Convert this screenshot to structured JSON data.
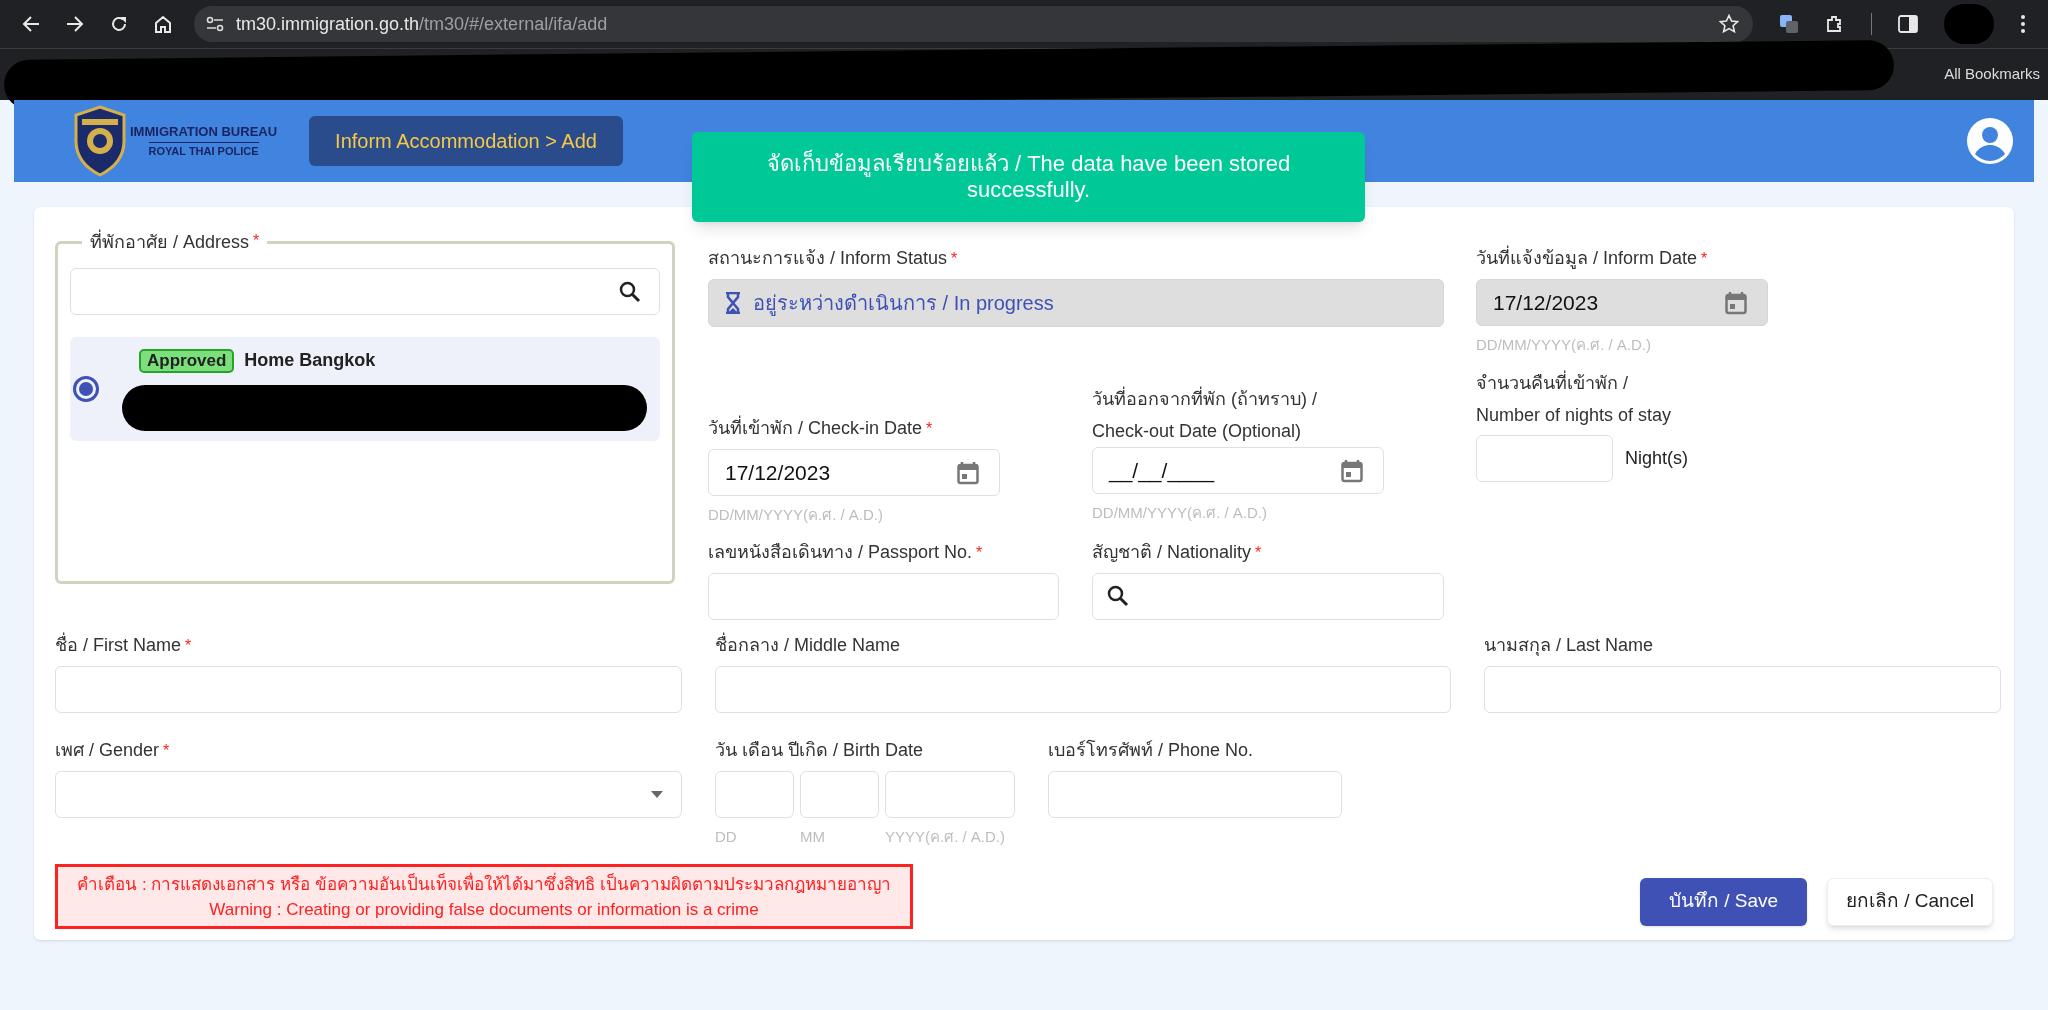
{
  "browser": {
    "url_host": "tm30.immigration.go.th",
    "url_path": "/tm30/#/external/ifa/add",
    "bookmarks_label": "All Bookmarks"
  },
  "header": {
    "logo_title": "IMMIGRATION BUREAU",
    "logo_subtitle": "ROYAL THAI POLICE",
    "breadcrumb": "Inform Accommodation > Add"
  },
  "toast": {
    "text": "จัดเก็บข้อมูลเรียบร้อยแล้ว / The data have been stored successfully."
  },
  "address": {
    "legend": "ที่พักอาศัย / Address",
    "required_mark": "*",
    "items": [
      {
        "selected": true,
        "badge": "Approved",
        "name": "Home Bangkok"
      }
    ]
  },
  "inform_status": {
    "label": "สถานะการแจ้ง / Inform Status",
    "required_mark": "*",
    "value": "อยู่ระหว่างดำเนินการ / In progress"
  },
  "inform_date": {
    "label": "วันที่แจ้งข้อมูล / Inform Date",
    "required_mark": "*",
    "value": "17/12/2023",
    "hint": "DD/MM/YYYY(ค.ศ. / A.D.)",
    "disabled": true
  },
  "check_in": {
    "label": "วันที่เข้าพัก / Check-in Date",
    "required_mark": "*",
    "value": "17/12/2023",
    "hint": "DD/MM/YYYY(ค.ศ. / A.D.)",
    "disabled": false
  },
  "check_out": {
    "label": "วันที่ออกจากที่พัก (ถ้าทราบ) / Check-out Date (Optional)",
    "value": "__/__/____",
    "hint": "DD/MM/YYYY(ค.ศ. / A.D.)",
    "disabled": false
  },
  "nights": {
    "label": "จำนวนคืนที่เข้าพัก / Number of nights of stay",
    "unit": "Night(s)"
  },
  "passport": {
    "label": "เลขหนังสือเดินทาง / Passport No.",
    "required_mark": "*"
  },
  "nationality": {
    "label": "สัญชาติ / Nationality",
    "required_mark": "*"
  },
  "first_name": {
    "label": "ชื่อ / First Name",
    "required_mark": "*"
  },
  "middle_name": {
    "label": "ชื่อกลาง / Middle Name"
  },
  "last_name": {
    "label": "นามสกุล / Last Name"
  },
  "gender": {
    "label": "เพศ / Gender",
    "required_mark": "*"
  },
  "birth_date": {
    "label": "วัน เดือน ปีเกิด / Birth Date",
    "parts": [
      {
        "hint": "DD"
      },
      {
        "hint": "MM"
      },
      {
        "hint": "YYYY(ค.ศ. / A.D.)"
      }
    ]
  },
  "phone": {
    "label": "เบอร์โทรศัพท์ / Phone No."
  },
  "warning": {
    "lines": [
      "คำเตือน : การแสดงเอกสาร หรือ ข้อความอันเป็นเท็จเพื่อให้ได้มาซึ่งสิทธิ เป็นความผิดตามประมวลกฎหมายอาญา",
      "Warning : Creating or providing false documents or information is a crime"
    ]
  },
  "buttons": {
    "save": "บันทึก / Save",
    "cancel": "ยกเลิก / Cancel"
  }
}
